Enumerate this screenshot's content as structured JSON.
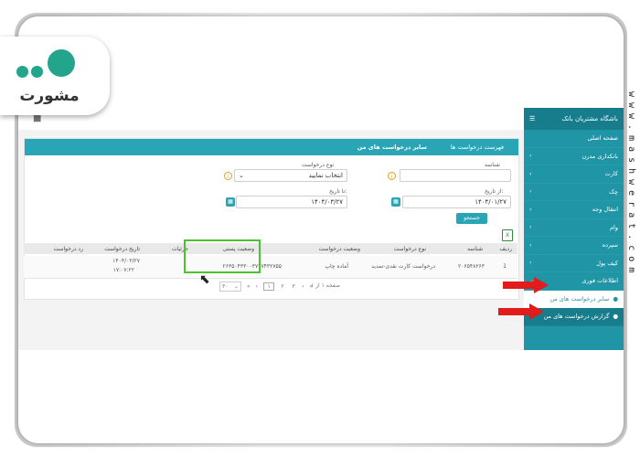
{
  "logo": {
    "text": "مشورت"
  },
  "watermark": {
    "text": "www.mashwerat.com"
  },
  "sidebar": {
    "brand": "باشگاه مشتریان بانک",
    "menu_icon": "hamburger-icon",
    "items": [
      {
        "label": "صفحه اصلی"
      },
      {
        "label": "بانکداری مدرن"
      },
      {
        "label": "کارت"
      },
      {
        "label": "چک"
      },
      {
        "label": "انتقال وجه"
      },
      {
        "label": "وام"
      },
      {
        "label": "سپرده"
      },
      {
        "label": "کیف پول"
      },
      {
        "label": "اطلاعات فوری"
      }
    ],
    "sub_items": [
      {
        "label": "سایر درخواست های من"
      },
      {
        "label": "گزارش درخواست های من"
      }
    ]
  },
  "tabs": [
    {
      "label": "سایر درخواست های من"
    },
    {
      "label": "فهرست درخواست ها"
    }
  ],
  "form": {
    "tracking_label": "شناسه",
    "tracking_value": "",
    "request_type_label": "نوع درخواست",
    "request_type_value": "انتخاب نمایید",
    "from_date_label": "از تاریخ:",
    "from_date_value": "۱۴۰۴/۰۱/۲۷",
    "to_date_label": "تا تاریخ:",
    "to_date_value": "۱۴۰۴/۰۳/۲۷",
    "search_button": "جستجو"
  },
  "table": {
    "headers": [
      "ردیف",
      "شناسه",
      "نوع درخواست",
      "وضعیت درخواست",
      "وضعیت پستی",
      "جزئیات",
      "تاریخ درخواست",
      "رد درخواست"
    ],
    "rows": [
      {
        "index": "1",
        "id": "۲۰۶۵۴۸۲۶۳",
        "type": "درخواست کارت نقدی-تمدید",
        "status": "آماده چاپ",
        "postal": "۲۶۳۵۰۴۳۳۰۰۳۷۲۷۴۳۲۷۵۵",
        "details": "",
        "date": "۱۴۰۴/۰۳/۲۷",
        "time": "۱۷:۰۷:۲۲",
        "reject": ""
      }
    ]
  },
  "pagination": {
    "page_size": "۳۰",
    "pages": [
      "۱",
      "۲",
      "۳"
    ],
    "current": "۱",
    "info": "صفحه ۱ از ۱"
  },
  "colors": {
    "primary": "#2aa5b6",
    "sidebar": "#1f95a6",
    "highlight": "#4cc232",
    "arrow": "#e21b1b",
    "logo": "#23a58c"
  }
}
